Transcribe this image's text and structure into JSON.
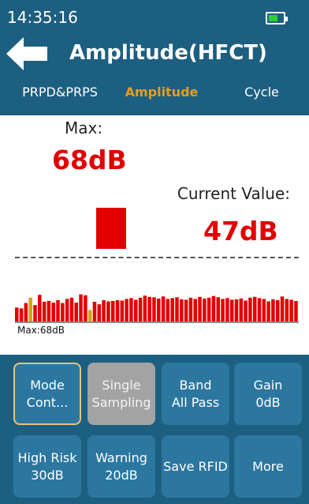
{
  "status_bar": {
    "time": "14:35:16",
    "battery_color": "#2fd12f"
  },
  "header": {
    "title": "Amplitude(HFCT)"
  },
  "tabs": [
    {
      "label": "PRPD&PRPS"
    },
    {
      "label": "Amplitude",
      "active": true
    },
    {
      "label": "Cycle"
    }
  ],
  "display": {
    "max_label": "Max:",
    "max_value": "68dB",
    "current_label": "Current Value:",
    "current_value": "47dB",
    "histogram_label": "Max:68dB",
    "histogram_bars": [
      0.34,
      0.32,
      0.45,
      0.58,
      0.4,
      0.65,
      0.48,
      0.5,
      0.46,
      0.52,
      0.45,
      0.55,
      0.58,
      0.46,
      0.66,
      0.64,
      0.28,
      0.48,
      0.42,
      0.52,
      0.49,
      0.5,
      0.52,
      0.51,
      0.55,
      0.57,
      0.53,
      0.58,
      0.63,
      0.6,
      0.59,
      0.56,
      0.61,
      0.55,
      0.57,
      0.59,
      0.54,
      0.53,
      0.58,
      0.55,
      0.6,
      0.56,
      0.58,
      0.62,
      0.59,
      0.55,
      0.57,
      0.53,
      0.54,
      0.56,
      0.51,
      0.58,
      0.6,
      0.57,
      0.55,
      0.49,
      0.54,
      0.52,
      0.61,
      0.55,
      0.53,
      0.5
    ],
    "histogram_highlight": [
      3,
      16
    ],
    "colors": {
      "accent_red": "#e20000",
      "highlight": "#d8a113",
      "tab_active": "#e49e1f"
    }
  },
  "buttons": [
    {
      "line1": "Mode",
      "line2": "Cont...",
      "state": "selected"
    },
    {
      "line1": "Single",
      "line2": "Sampling",
      "state": "disabled"
    },
    {
      "line1": "Band",
      "line2": "All Pass",
      "state": "normal"
    },
    {
      "line1": "Gain",
      "line2": "0dB",
      "state": "normal"
    },
    {
      "line1": "High Risk",
      "line2": "30dB",
      "state": "normal"
    },
    {
      "line1": "Warning",
      "line2": "20dB",
      "state": "normal"
    },
    {
      "line1": "Save RFID",
      "line2": "",
      "state": "normal"
    },
    {
      "line1": "More",
      "line2": "",
      "state": "normal"
    }
  ]
}
